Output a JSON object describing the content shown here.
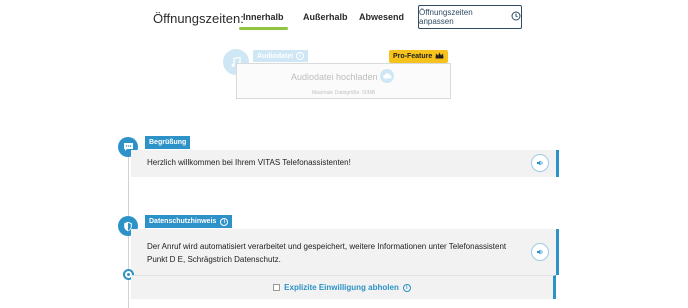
{
  "header": {
    "label": "Öffnungszeiten:",
    "tabs": [
      {
        "label": "Innerhalb",
        "active": true
      },
      {
        "label": "Außerhalb",
        "active": false
      },
      {
        "label": "Abwesend",
        "active": false
      }
    ],
    "adjust_button": "Öffnungszeiten anpassen"
  },
  "audio": {
    "tag": "Audiodatei",
    "pro_badge": "Pro-Feature",
    "upload_label": "Audiodatei hochladen",
    "upload_hint": "Maximale Dateigröße: 50MB"
  },
  "sections": {
    "greeting": {
      "tag": "Begrüßung",
      "text": "Herzlich willkommen bei Ihrem VITAS Telefonassistenten!"
    },
    "privacy": {
      "tag": "Datenschutzhinweis",
      "text_line1": "Der Anruf wird automatisiert verarbeitet und gespeichert, weitere Informationen unter Telefonassistent",
      "text_line2": "Punkt D E, Schrägstrich Datenschutz.",
      "consent_label": "Explizite Einwilligung abholen"
    }
  },
  "colors": {
    "accent": "#2c92c8",
    "tab_underline": "#8fc640",
    "pro": "#f6c21b"
  }
}
